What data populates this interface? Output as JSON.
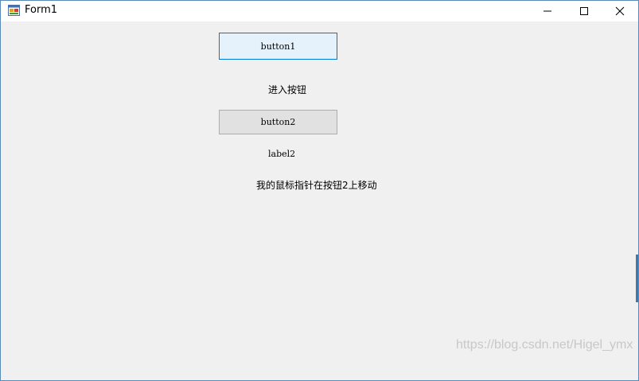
{
  "window": {
    "title": "Form1"
  },
  "titlebar": {
    "icons": {
      "app": "form-app-icon",
      "minimize": "minimize-icon",
      "maximize": "maximize-icon",
      "close": "close-icon"
    }
  },
  "controls": {
    "button1_label": "button1",
    "label1_text": "进入按钮",
    "button2_label": "button2",
    "label2_text": "label2",
    "label3_text": "我的鼠标指针在按钮2上移动"
  },
  "watermark": {
    "text": "https://blog.csdn.net/Higel_ymx"
  },
  "colors": {
    "accent": "#0078d7",
    "client_bg": "#f0f0f0",
    "button_hover_bg": "#e5f1fb",
    "button_bg": "#e1e1e1"
  }
}
